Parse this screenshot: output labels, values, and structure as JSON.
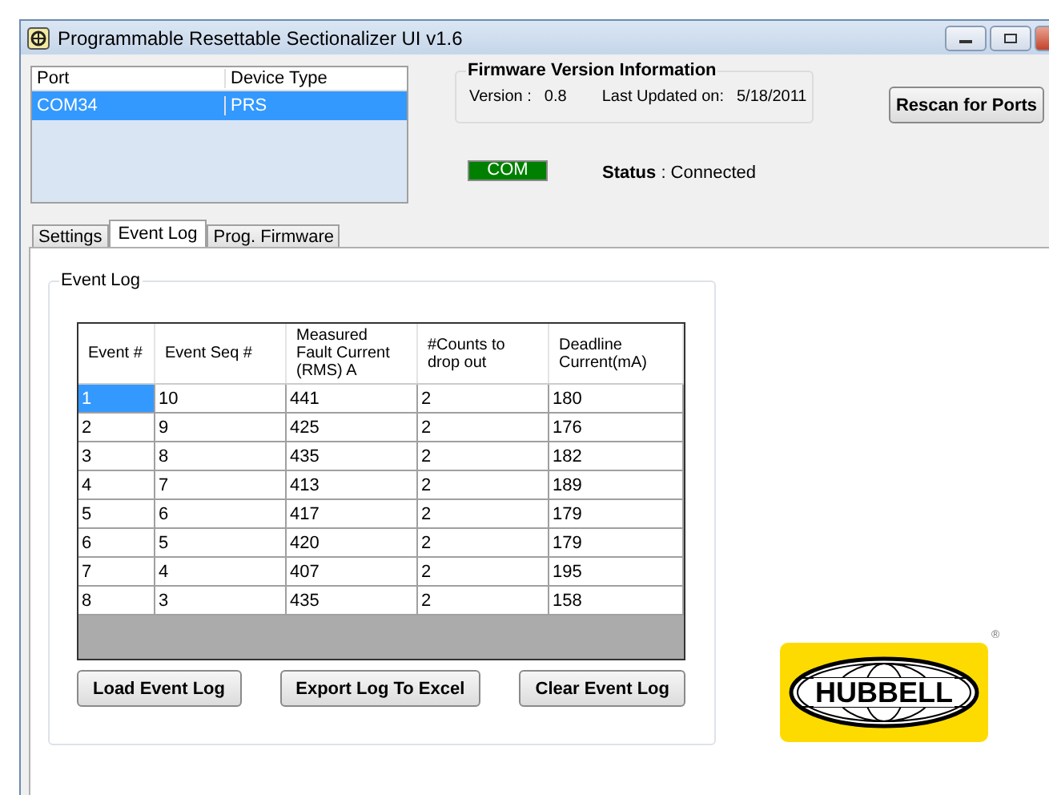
{
  "window": {
    "title": "Programmable Resettable Sectionalizer UI v1.6"
  },
  "port_list": {
    "columns": [
      "Port",
      "Device Type"
    ],
    "rows": [
      {
        "cells": [
          "COM34",
          "PRS"
        ],
        "selected": true
      }
    ]
  },
  "firmware": {
    "title": "Firmware Version Information",
    "version_label": "Version :",
    "version": "0.8",
    "updated_label": "Last Updated on:",
    "updated": "5/18/2011"
  },
  "connection_indicator": {
    "label": "COM",
    "on": true
  },
  "status": {
    "label": "Status",
    "value": ": Connected"
  },
  "rescan_button": "Rescan for Ports",
  "tabs": [
    {
      "label": "Settings",
      "selected": false
    },
    {
      "label": "Event Log",
      "selected": true
    },
    {
      "label": "Prog. Firmware",
      "selected": false
    }
  ],
  "event_log": {
    "title": "Event Log",
    "columns": [
      "Event #",
      "Event Seq #",
      "Measured Fault Current (RMS) A",
      "#Counts to drop out",
      "Deadline Current(mA)"
    ],
    "rows": [
      {
        "cells": [
          "1",
          "10",
          "441",
          "2",
          "180"
        ],
        "selected": true
      },
      {
        "cells": [
          "2",
          "9",
          "425",
          "2",
          "176"
        ],
        "selected": false
      },
      {
        "cells": [
          "3",
          "8",
          "435",
          "2",
          "182"
        ],
        "selected": false
      },
      {
        "cells": [
          "4",
          "7",
          "413",
          "2",
          "189"
        ],
        "selected": false
      },
      {
        "cells": [
          "5",
          "6",
          "417",
          "2",
          "179"
        ],
        "selected": false
      },
      {
        "cells": [
          "6",
          "5",
          "420",
          "2",
          "179"
        ],
        "selected": false
      },
      {
        "cells": [
          "7",
          "4",
          "407",
          "2",
          "195"
        ],
        "selected": false
      },
      {
        "cells": [
          "8",
          "3",
          "435",
          "2",
          "158"
        ],
        "selected": false
      }
    ],
    "buttons": [
      "Load Event Log",
      "Export Log To Excel",
      "Clear Event Log"
    ]
  },
  "logo": {
    "text": "HUBBELL",
    "mark": "®"
  }
}
